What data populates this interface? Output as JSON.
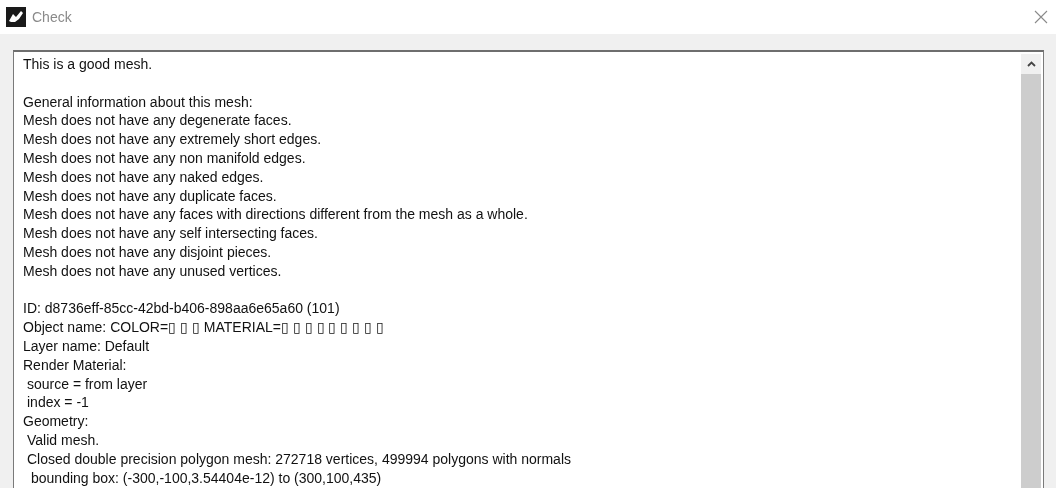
{
  "window": {
    "title": "Check"
  },
  "report": {
    "blocks": [
      {
        "lines": [
          {
            "text": "This is a good mesh."
          }
        ]
      },
      {
        "lines": [
          {
            "text": "General information about this mesh:"
          },
          {
            "text": "Mesh does not have any degenerate faces."
          },
          {
            "text": "Mesh does not have any extremely short edges."
          },
          {
            "text": "Mesh does not have any non manifold edges."
          },
          {
            "text": "Mesh does not have any naked edges."
          },
          {
            "text": "Mesh does not have any duplicate faces."
          },
          {
            "text": "Mesh does not have any faces with directions different from the mesh as a whole."
          },
          {
            "text": "Mesh does not have any self intersecting faces."
          },
          {
            "text": "Mesh does not have any disjoint pieces."
          },
          {
            "text": "Mesh does not have any unused vertices."
          }
        ]
      },
      {
        "lines": [
          {
            "text": "ID: d8736eff-85cc-42bd-b406-898aa6e65a60 (101)"
          },
          {
            "text": "Object name: COLOR=▯ ▯ ▯  MATERIAL=▯ ▯ ▯  ▯ ▯ ▯  ▯ ▯ ▯"
          },
          {
            "text": "Layer name: Default"
          },
          {
            "text": "Render Material:",
            "children": [
              {
                "text": "source = from layer"
              },
              {
                "text": "index = -1"
              }
            ]
          },
          {
            "text": "Geometry:",
            "children": [
              {
                "text": "Valid mesh."
              },
              {
                "text": "Closed double precision polygon mesh: 272718 vertices, 499994 polygons with normals",
                "children": [
                  {
                    "text": "bounding box: (-300,-100,3.54404e-12) to (300,100,435)"
                  }
                ]
              }
            ]
          }
        ]
      }
    ]
  }
}
